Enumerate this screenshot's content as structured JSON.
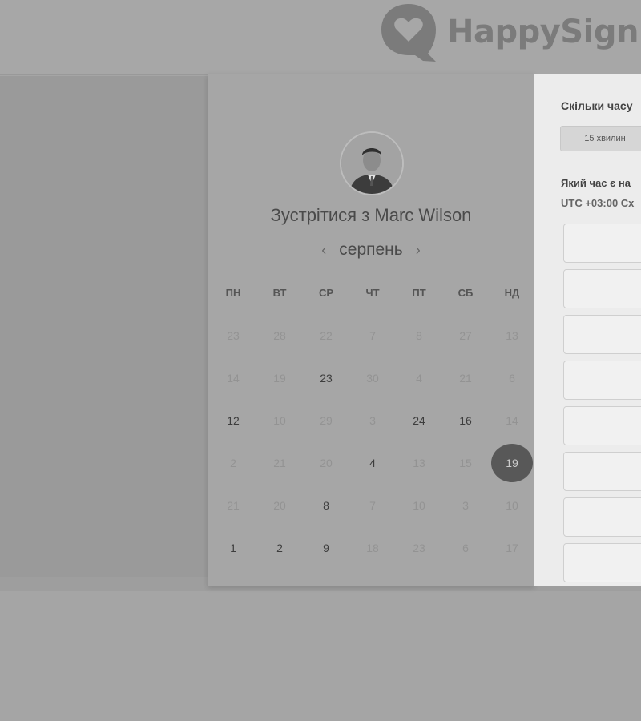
{
  "brand": {
    "name": "HappySign"
  },
  "meeting": {
    "title": "Зустрітися з Marc Wilson"
  },
  "calendar": {
    "month": "серпень",
    "prev_icon": "‹",
    "next_icon": "›",
    "weekdays": [
      "ПН",
      "ВТ",
      "СР",
      "ЧТ",
      "ПТ",
      "СБ",
      "НД"
    ],
    "weeks": [
      [
        "23",
        "28",
        "22",
        "7",
        "8",
        "27",
        "13"
      ],
      [
        "14",
        "19",
        "23",
        "30",
        "4",
        "21",
        "6"
      ],
      [
        "12",
        "10",
        "29",
        "3",
        "24",
        "16",
        "14"
      ],
      [
        "2",
        "21",
        "20",
        "4",
        "13",
        "15",
        "19"
      ],
      [
        "21",
        "20",
        "8",
        "7",
        "10",
        "3",
        "10"
      ],
      [
        "1",
        "2",
        "9",
        "18",
        "23",
        "6",
        "17"
      ]
    ],
    "active_cells": [
      "1.2",
      "2.0",
      "2.4",
      "2.5",
      "3.3",
      "4.2",
      "5.0",
      "5.1",
      "5.2"
    ],
    "selected_cell": "3.6"
  },
  "side": {
    "duration_heading": "Скільки часу",
    "duration_option": "15 хвилин",
    "time_heading": "Який час є на",
    "timezone": "UTC +03:00 Сх"
  }
}
